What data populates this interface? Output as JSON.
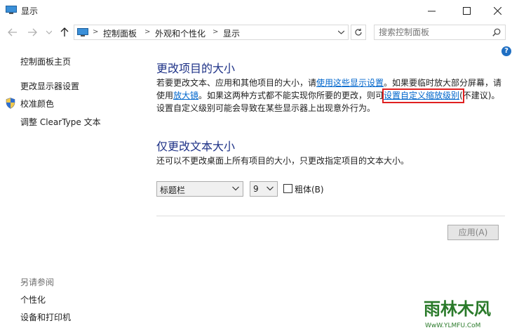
{
  "window": {
    "title": "显示"
  },
  "address": {
    "crumbs": [
      "控制面板",
      "外观和个性化",
      "显示"
    ]
  },
  "search": {
    "placeholder": "搜索控制面板"
  },
  "help_label": "?",
  "sidebar": {
    "items": [
      "控制面板主页",
      "更改显示器设置",
      "校准颜色",
      "调整 ClearType 文本"
    ],
    "see_also_title": "另请参阅",
    "see_also": [
      "个性化",
      "设备和打印机"
    ]
  },
  "section1": {
    "title": "更改项目的大小",
    "text_a": "若要更改文本、应用和其他项目的大小，请",
    "link_a": "使用这些显示设置",
    "text_b": "。如果要临时放大部分屏幕，请使用",
    "link_b": "放大镜",
    "text_c": "。如果这两种方式都不能实现你所要的更改，则可",
    "link_c": "设置自定义缩放级别",
    "text_d": "(不建议)。设置自定义级别可能会导致在某些显示器上出现意外行为。"
  },
  "section2": {
    "title": "仅更改文本大小",
    "desc": "还可以不更改桌面上所有项目的大小，只更改指定项目的文本大小。",
    "item_select": "标题栏",
    "size_select": "9",
    "bold_label": "粗体(B)"
  },
  "apply_label": "应用(A)",
  "watermark": {
    "brand": "雨林木风",
    "url": "WwW.YLMFU.CoM"
  },
  "colors": {
    "heading": "#1e3287",
    "link": "#0066cc",
    "highlight": "#e02020"
  }
}
